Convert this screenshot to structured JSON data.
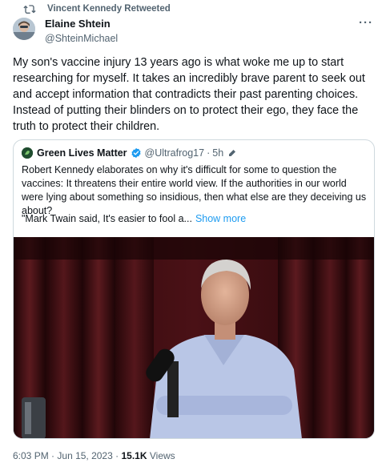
{
  "retweet": {
    "text": "Vincent Kennedy Retweeted",
    "icon": "retweet-icon"
  },
  "author": {
    "name": "Elaine Shtein",
    "handle": "@ShteinMichael",
    "avatar": "avatar"
  },
  "more_menu": {
    "label": "···",
    "icon": "more-icon"
  },
  "tweet": {
    "text": "My son's vaccine injury 13 years ago is what woke me up to start\nresearching for myself. It takes an incredibly brave parent to seek out\nand accept information that contradicts their past parenting choices.\nInstead of putting their blinders on to protect their ego, they face the\ntruth to protect their children."
  },
  "quote": {
    "name": "Green Lives Matter",
    "handle": "@Ultrafrog17",
    "separator": "·",
    "time": "5h",
    "verified_color": "#1d9bf0",
    "text": "Robert Kennedy elaborates on why it's difficult for some to question the\nvaccines: It threatens their entire world view. If the authorities in our world\nwere lying about something so insidious, then what else are they deceiving us\nabout?",
    "truncated_text": "\"Mark Twain said, It's easier to fool a...",
    "show_more": "Show more",
    "media": "video-thumbnail"
  },
  "meta": {
    "time": "6:03 PM",
    "sep1": "·",
    "date": "Jun 15, 2023",
    "sep2": "·",
    "views_count": "15.1K",
    "views_label": "Views"
  },
  "colors": {
    "accent": "#1d9bf0",
    "secondary_text": "#536471",
    "border": "#cfd9de"
  }
}
